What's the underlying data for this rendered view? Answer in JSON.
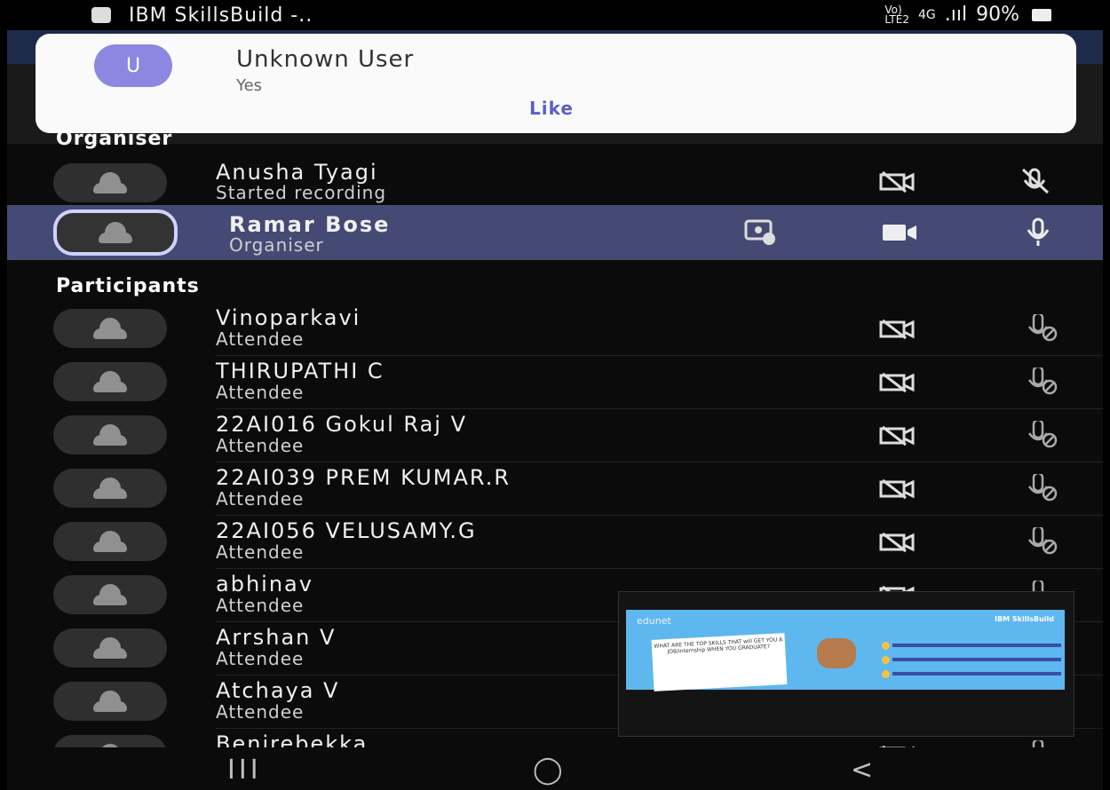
{
  "status_bar": {
    "app_title": "IBM SkillsBuild -..",
    "network_top": "Vo)",
    "network_bottom": "LTE2",
    "signal": "4G",
    "signal_bars": ".ııl",
    "battery": "90%"
  },
  "notification": {
    "avatar_initial": "U",
    "sender": "Unknown User",
    "message": "Yes",
    "action": "Like"
  },
  "organiser_section": "Organiser",
  "organisers": [
    {
      "name": "Anusha Tyagi",
      "role": "Started recording"
    },
    {
      "name": "Ramar Bose",
      "role": "Organiser"
    }
  ],
  "participants_section": "Participants",
  "participants": [
    {
      "name": "Vinoparkavi",
      "role": "Attendee"
    },
    {
      "name": "THIRUPATHI C",
      "role": "Attendee"
    },
    {
      "name": "22AI016 Gokul Raj V",
      "role": "Attendee"
    },
    {
      "name": "22AI039 PREM KUMAR.R",
      "role": "Attendee"
    },
    {
      "name": "22AI056 VELUSAMY.G",
      "role": "Attendee"
    },
    {
      "name": "abhinav",
      "role": "Attendee"
    },
    {
      "name": "Arrshan V",
      "role": "Attendee"
    },
    {
      "name": "Atchaya V",
      "role": "Attendee"
    },
    {
      "name": "Benirebekka",
      "role": ""
    }
  ],
  "pip": {
    "brand_left": "edunet",
    "brand_right": "IBM SkillsBuild",
    "slide_text": "WHAT ARE THE TOP SKILLS THAT will GET YOU A JOB/internship WHEN YOU GRADUATE?"
  },
  "nav": {
    "recent": "III",
    "home": "◯",
    "back": "<"
  }
}
